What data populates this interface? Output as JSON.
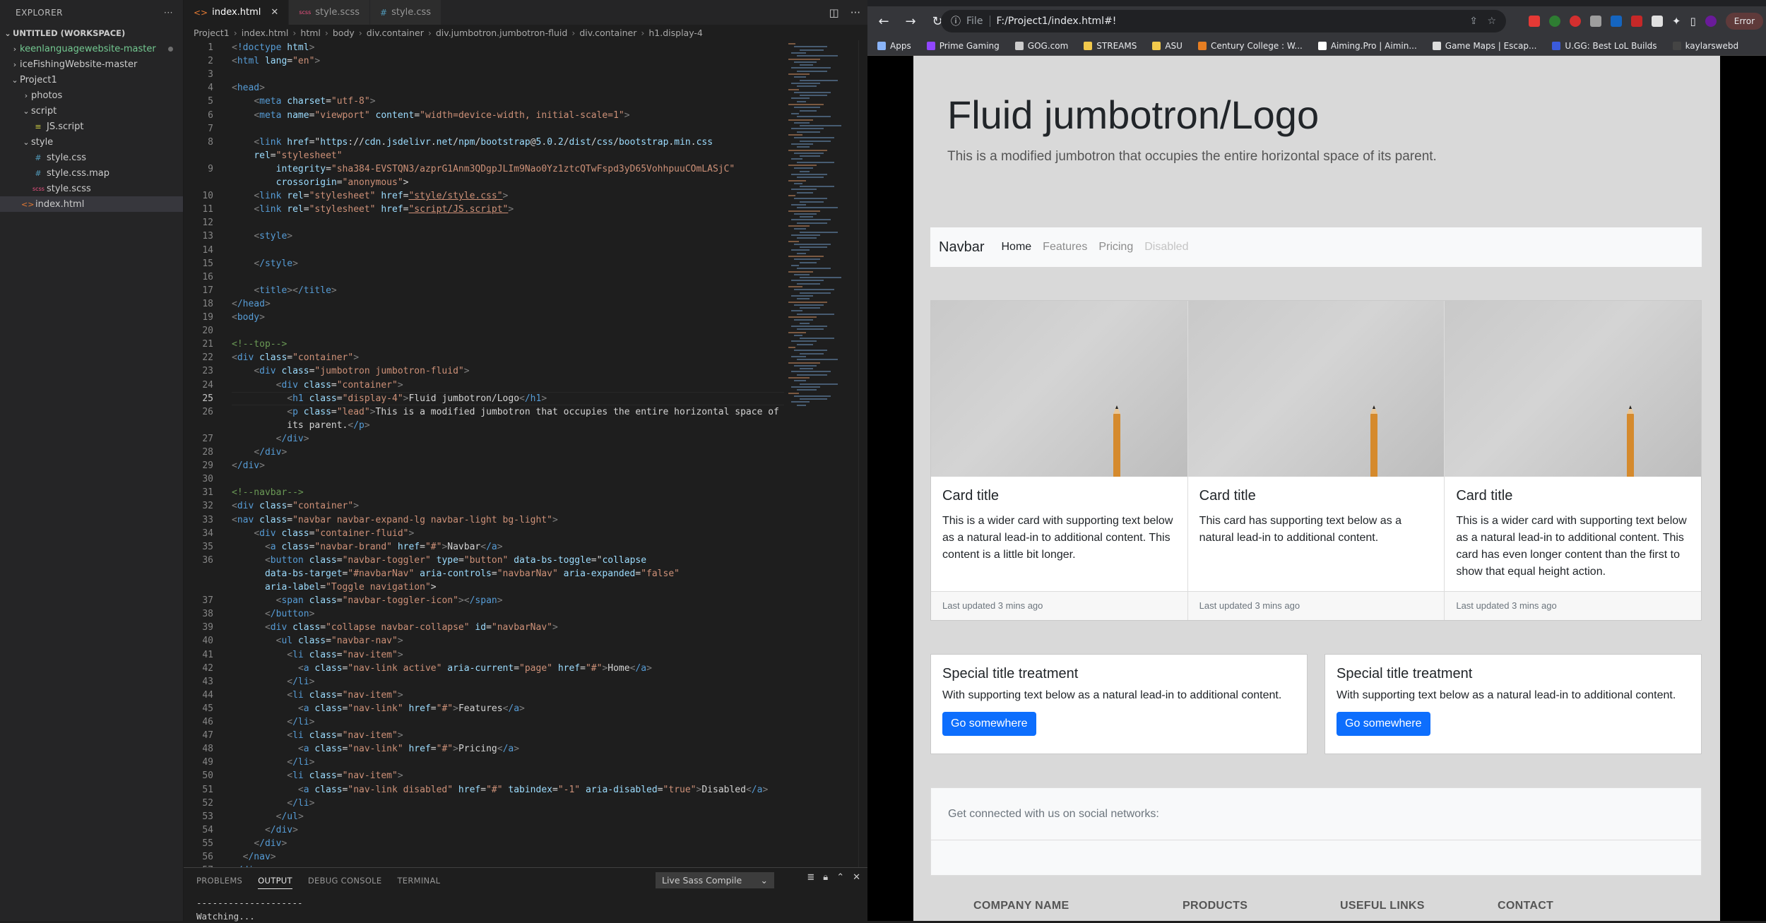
{
  "explorer": {
    "title": "EXPLORER",
    "workspace": "UNTITLED (WORKSPACE)",
    "items": [
      {
        "label": "keenlanguagewebsite-master",
        "type": "folder",
        "open": false,
        "depth": 0,
        "color": "#73c991"
      },
      {
        "label": "iceFishingWebsite-master",
        "type": "folder",
        "open": false,
        "depth": 0
      },
      {
        "label": "Project1",
        "type": "folder",
        "open": true,
        "depth": 0
      },
      {
        "label": "photos",
        "type": "folder",
        "open": false,
        "depth": 1
      },
      {
        "label": "script",
        "type": "folder",
        "open": true,
        "depth": 1
      },
      {
        "label": "JS.script",
        "type": "file",
        "icon": "≡",
        "depth": 2
      },
      {
        "label": "style",
        "type": "folder",
        "open": true,
        "depth": 1
      },
      {
        "label": "style.css",
        "type": "file",
        "icon": "#",
        "depth": 2
      },
      {
        "label": "style.css.map",
        "type": "file",
        "icon": "#",
        "depth": 2
      },
      {
        "label": "style.scss",
        "type": "file",
        "icon": "scss",
        "depth": 2
      },
      {
        "label": "index.html",
        "type": "file",
        "icon": "<>",
        "depth": 1,
        "selected": true
      }
    ]
  },
  "tabs": [
    {
      "label": "index.html",
      "active": true,
      "icon": "<>"
    },
    {
      "label": "style.scss",
      "active": false,
      "icon": "scss"
    },
    {
      "label": "style.css",
      "active": false,
      "icon": "#"
    }
  ],
  "breadcrumbs": [
    "Project1",
    "index.html",
    "html",
    "body",
    "div.container",
    "div.jumbotron.jumbotron-fluid",
    "div.container",
    "h1.display-4"
  ],
  "code": [
    {
      "n": "1",
      "t": "<!doctype html>"
    },
    {
      "n": "2",
      "t": "<html lang=\"en\">"
    },
    {
      "n": "3",
      "t": ""
    },
    {
      "n": "4",
      "t": "<head>"
    },
    {
      "n": "5",
      "t": "    <meta charset=\"utf-8\">"
    },
    {
      "n": "6",
      "t": "    <meta name=\"viewport\" content=\"width=device-width, initial-scale=1\">"
    },
    {
      "n": "7",
      "t": ""
    },
    {
      "n": "8",
      "t": "    <link href=\"https://cdn.jsdelivr.net/npm/bootstrap@5.0.2/dist/css/bootstrap.min.css\""
    },
    {
      "n": "",
      "t": "    rel=\"stylesheet\""
    },
    {
      "n": "9",
      "t": "        integrity=\"sha384-EVSTQN3/azprG1Anm3QDgpJLIm9Nao0Yz1ztcQTwFspd3yD65VohhpuuCOmLASjC\""
    },
    {
      "n": "",
      "t": "        crossorigin=\"anonymous\">"
    },
    {
      "n": "10",
      "t": "    <link rel=\"stylesheet\" href=\"style/style.css\">"
    },
    {
      "n": "11",
      "t": "    <link rel=\"stylesheet\" href=\"script/JS.script\">"
    },
    {
      "n": "12",
      "t": ""
    },
    {
      "n": "13",
      "t": "    <style>"
    },
    {
      "n": "14",
      "t": ""
    },
    {
      "n": "15",
      "t": "    </style>"
    },
    {
      "n": "16",
      "t": ""
    },
    {
      "n": "17",
      "t": "    <title></title>"
    },
    {
      "n": "18",
      "t": "</head>"
    },
    {
      "n": "19",
      "t": "<body>"
    },
    {
      "n": "20",
      "t": ""
    },
    {
      "n": "21",
      "t": "<!--top-->"
    },
    {
      "n": "22",
      "t": "<div class=\"container\">"
    },
    {
      "n": "23",
      "t": "    <div class=\"jumbotron jumbotron-fluid\">"
    },
    {
      "n": "24",
      "t": "        <div class=\"container\">"
    },
    {
      "n": "25",
      "t": "          <h1 class=\"display-4\">Fluid jumbotron/Logo</h1>",
      "cur": true
    },
    {
      "n": "26",
      "t": "          <p class=\"lead\">This is a modified jumbotron that occupies the entire horizontal space of"
    },
    {
      "n": "",
      "t": "          its parent.</p>"
    },
    {
      "n": "27",
      "t": "        </div>"
    },
    {
      "n": "28",
      "t": "    </div>"
    },
    {
      "n": "29",
      "t": "</div>"
    },
    {
      "n": "30",
      "t": ""
    },
    {
      "n": "31",
      "t": "<!--navbar-->"
    },
    {
      "n": "32",
      "t": "<div class=\"container\">"
    },
    {
      "n": "33",
      "t": "<nav class=\"navbar navbar-expand-lg navbar-light bg-light\">"
    },
    {
      "n": "34",
      "t": "    <div class=\"container-fluid\">"
    },
    {
      "n": "35",
      "t": "      <a class=\"navbar-brand\" href=\"#\">Navbar</a>"
    },
    {
      "n": "36",
      "t": "      <button class=\"navbar-toggler\" type=\"button\" data-bs-toggle=\"collapse\""
    },
    {
      "n": "",
      "t": "      data-bs-target=\"#navbarNav\" aria-controls=\"navbarNav\" aria-expanded=\"false\""
    },
    {
      "n": "",
      "t": "      aria-label=\"Toggle navigation\">"
    },
    {
      "n": "37",
      "t": "        <span class=\"navbar-toggler-icon\"></span>"
    },
    {
      "n": "38",
      "t": "      </button>"
    },
    {
      "n": "39",
      "t": "      <div class=\"collapse navbar-collapse\" id=\"navbarNav\">"
    },
    {
      "n": "40",
      "t": "        <ul class=\"navbar-nav\">"
    },
    {
      "n": "41",
      "t": "          <li class=\"nav-item\">"
    },
    {
      "n": "42",
      "t": "            <a class=\"nav-link active\" aria-current=\"page\" href=\"#\">Home</a>"
    },
    {
      "n": "43",
      "t": "          </li>"
    },
    {
      "n": "44",
      "t": "          <li class=\"nav-item\">"
    },
    {
      "n": "45",
      "t": "            <a class=\"nav-link\" href=\"#\">Features</a>"
    },
    {
      "n": "46",
      "t": "          </li>"
    },
    {
      "n": "47",
      "t": "          <li class=\"nav-item\">"
    },
    {
      "n": "48",
      "t": "            <a class=\"nav-link\" href=\"#\">Pricing</a>"
    },
    {
      "n": "49",
      "t": "          </li>"
    },
    {
      "n": "50",
      "t": "          <li class=\"nav-item\">"
    },
    {
      "n": "51",
      "t": "            <a class=\"nav-link disabled\" href=\"#\" tabindex=\"-1\" aria-disabled=\"true\">Disabled</a>"
    },
    {
      "n": "52",
      "t": "          </li>"
    },
    {
      "n": "53",
      "t": "        </ul>"
    },
    {
      "n": "54",
      "t": "      </div>"
    },
    {
      "n": "55",
      "t": "    </div>"
    },
    {
      "n": "56",
      "t": "  </nav>"
    },
    {
      "n": "57",
      "t": "</div>"
    }
  ],
  "panel": {
    "tabs": [
      "PROBLEMS",
      "OUTPUT",
      "DEBUG CONSOLE",
      "TERMINAL"
    ],
    "active_tab": "OUTPUT",
    "selector": "Live Sass Compile",
    "output": "--------------------\nWatching..."
  },
  "browser": {
    "url_scheme": "File",
    "url": "F:/Project1/index.html#!",
    "error_label": "Error",
    "bookmarks": [
      {
        "label": "Apps",
        "color": "#8ab4f8"
      },
      {
        "label": "Prime Gaming",
        "color": "#9146ff"
      },
      {
        "label": "GOG.com",
        "color": "#cccccc"
      },
      {
        "label": "STREAMS",
        "color": "#f2c94c"
      },
      {
        "label": "ASU",
        "color": "#f2c94c"
      },
      {
        "label": "Century College : W...",
        "color": "#e67e22"
      },
      {
        "label": "Aiming.Pro | Aimin...",
        "color": "#ffffff"
      },
      {
        "label": "Game Maps | Escap...",
        "color": "#dddddd"
      },
      {
        "label": "U.GG: Best LoL Builds",
        "color": "#3b5bdb"
      },
      {
        "label": "kaylarswebd",
        "color": "#444444"
      }
    ]
  },
  "site": {
    "jumbotron": {
      "title": "Fluid jumbotron/Logo",
      "lead": "This is a modified jumbotron that occupies the entire horizontal space of its parent."
    },
    "navbar": {
      "brand": "Navbar",
      "links": [
        {
          "label": "Home",
          "state": "active"
        },
        {
          "label": "Features",
          "state": "normal"
        },
        {
          "label": "Pricing",
          "state": "normal"
        },
        {
          "label": "Disabled",
          "state": "disabled"
        }
      ]
    },
    "cards": [
      {
        "title": "Card title",
        "text": "This is a wider card with supporting text below as a natural lead-in to additional content. This content is a little bit longer.",
        "footer": "Last updated 3 mins ago"
      },
      {
        "title": "Card title",
        "text": "This card has supporting text below as a natural lead-in to additional content.",
        "footer": "Last updated 3 mins ago"
      },
      {
        "title": "Card title",
        "text": "This is a wider card with supporting text below as a natural lead-in to additional content. This card has even longer content than the first to show that equal height action.",
        "footer": "Last updated 3 mins ago"
      }
    ],
    "special": [
      {
        "title": "Special title treatment",
        "text": "With supporting text below as a natural lead-in to additional content.",
        "button": "Go somewhere"
      },
      {
        "title": "Special title treatment",
        "text": "With supporting text below as a natural lead-in to additional content.",
        "button": "Go somewhere"
      }
    ],
    "social_text": "Get connected with us on social networks:",
    "footer_cols": [
      "COMPANY NAME",
      "PRODUCTS",
      "USEFUL LINKS",
      "CONTACT"
    ]
  }
}
